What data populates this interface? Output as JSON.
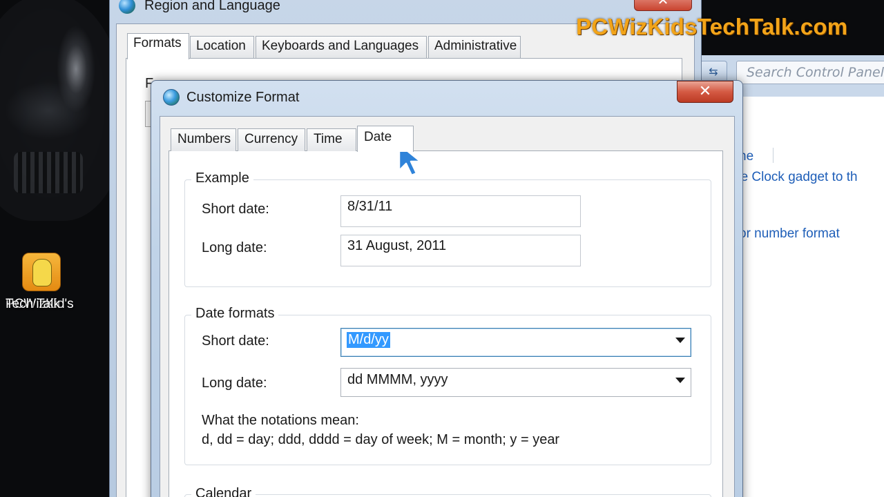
{
  "desktop": {
    "icon_label_line1": "PCWizKid's",
    "icon_label_line2": "Tech Talk",
    "watermark": "PCWizKidsTechTalk.com"
  },
  "control_panel": {
    "search_placeholder": "Search Control Panel",
    "links": [
      "ne",
      "he Clock gadget to th",
      "or number format"
    ]
  },
  "region_language": {
    "title": "Region and Language",
    "tabs": [
      "Formats",
      "Location",
      "Keyboards and Languages",
      "Administrative"
    ],
    "active_tab": "Formats",
    "peek_text": "F"
  },
  "customize_format": {
    "title": "Customize Format",
    "close_label": "✕",
    "tabs": [
      "Numbers",
      "Currency",
      "Time",
      "Date"
    ],
    "active_tab": "Date",
    "example": {
      "title": "Example",
      "short_label": "Short date:",
      "short_value": "8/31/11",
      "long_label": "Long date:",
      "long_value": "31 August, 2011"
    },
    "date_formats": {
      "title": "Date formats",
      "short_label": "Short date:",
      "short_value": "M/d/yy",
      "long_label": "Long date:",
      "long_value": "dd MMMM, yyyy",
      "notations_heading": "What the notations mean:",
      "notations_text": "d, dd = day;  ddd, dddd = day of week;  M = month;  y = year"
    },
    "calendar": {
      "title": "Calendar"
    }
  },
  "colors": {
    "watermark": "#f2a419",
    "selection": "#3399ff",
    "link": "#1e5eb8",
    "close_button": "#c9432f"
  }
}
